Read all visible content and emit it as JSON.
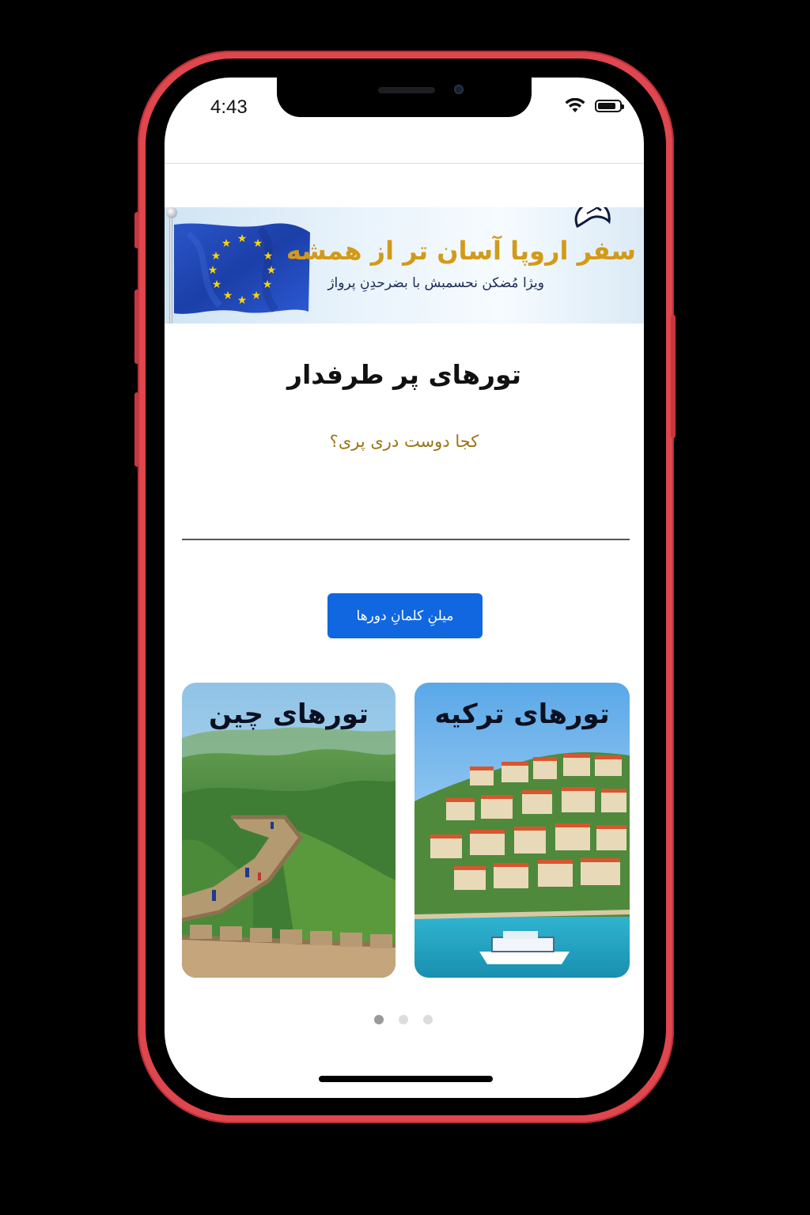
{
  "status_bar": {
    "time": "4:43"
  },
  "banner": {
    "title": "سفر اروپا آسان تر از همشه",
    "subtitle": "ویژا مُضکن نحسمبش با بضرحدِنِ پرواژ"
  },
  "section": {
    "title": "تورهای پر طرفدار",
    "subtitle": "کجا دوست دری پری؟"
  },
  "all_tours_button": {
    "label": "میلنِ کلمانِ دورها"
  },
  "cards": [
    {
      "title": "تورهای چین"
    },
    {
      "title": "تورهای ترکیه"
    }
  ],
  "carousel": {
    "total": 3,
    "active_index": 0
  },
  "colors": {
    "phone_frame": "#e0464e",
    "accent_button": "#1167e0",
    "banner_title": "#d39a18",
    "section_subtitle": "#9a7414"
  }
}
